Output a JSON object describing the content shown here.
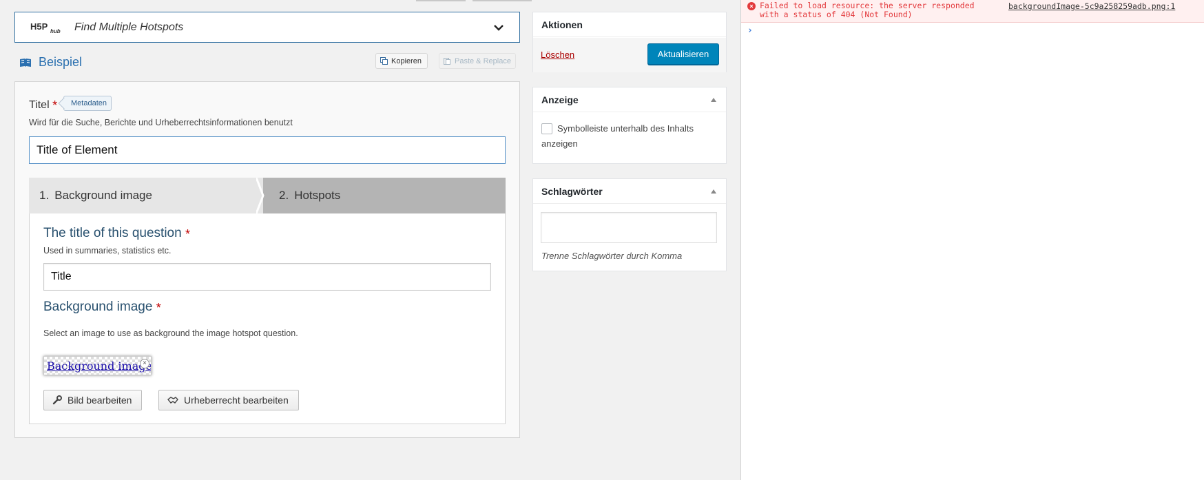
{
  "editor": {
    "library_name": "Find Multiple Hotspots",
    "logo_text": "H5P hub",
    "example_label": "Beispiel",
    "copy_label": "Kopieren",
    "paste_label": "Paste & Replace",
    "title_field": {
      "label": "Titel",
      "required_mark": "*",
      "metadata_label": "Metadaten",
      "description": "Wird für die Suche, Berichte und Urheberrechtsinformationen benutzt",
      "value": "Title of Element"
    },
    "wizard": {
      "steps": [
        {
          "number": "1.",
          "label": "Background image"
        },
        {
          "number": "2.",
          "label": "Hotspots"
        }
      ]
    },
    "question_title": {
      "label": "The title of this question",
      "required_mark": "*",
      "description": "Used in summaries, statistics etc.",
      "value": "Title"
    },
    "background_image": {
      "label": "Background image",
      "required_mark": "*",
      "description": "Select an image to use as background the image hotspot question.",
      "alt_text": "Background image",
      "remove_symbol": "×",
      "edit_image_label": "Bild bearbeiten",
      "edit_copyright_label": "Urheberrecht bearbeiten"
    }
  },
  "sidebar": {
    "actions": {
      "title": "Aktionen",
      "delete_label": "Löschen",
      "update_label": "Aktualisieren"
    },
    "display": {
      "title": "Anzeige",
      "checkbox_label": "Symbolleiste unterhalb des Inhalts anzeigen",
      "checked": false
    },
    "tags": {
      "title": "Schlagwörter",
      "hint": "Trenne Schlagwörter durch Komma"
    }
  },
  "console": {
    "error_icon": "×",
    "error_message": "Failed to load resource: the server responded with a status of 404 (Not Found)",
    "error_source": "backgroundImage-5c9a258259adb.png:1",
    "prompt": "›"
  },
  "colors": {
    "accent_blue": "#0085ba",
    "link_blue": "#2b70b0",
    "required_red": "#c10000",
    "console_error_red": "#e3393c"
  }
}
